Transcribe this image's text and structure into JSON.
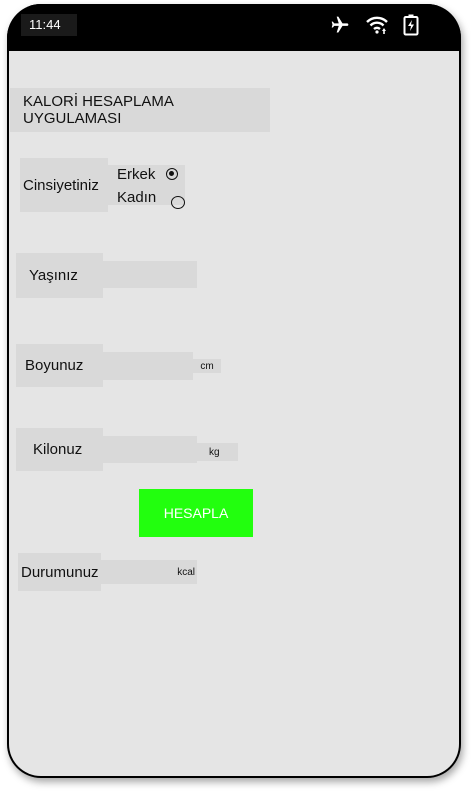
{
  "status_bar": {
    "time": "11:44",
    "icons": [
      "airplane-mode-icon",
      "wifi-icon",
      "battery-charging-icon"
    ]
  },
  "app": {
    "title": "KALORİ HESAPLAMA UYGULAMASI",
    "colors": {
      "button": "#22ff0e",
      "screen_bg": "#e5e5e5",
      "field_bg": "#d9d9d9"
    }
  },
  "gender": {
    "label": "Cinsiyetiniz",
    "options": [
      {
        "label": "Erkek",
        "checked": true
      },
      {
        "label": "Kadın",
        "checked": false
      }
    ]
  },
  "age": {
    "label": "Yaşınız",
    "value": ""
  },
  "height": {
    "label": "Boyunuz",
    "value": "",
    "unit": "cm"
  },
  "weight": {
    "label": "Kilonuz",
    "value": "",
    "unit": "kg"
  },
  "calculate": {
    "label": "HESAPLA"
  },
  "result": {
    "label": "Durumunuz",
    "unit": "kcal"
  }
}
